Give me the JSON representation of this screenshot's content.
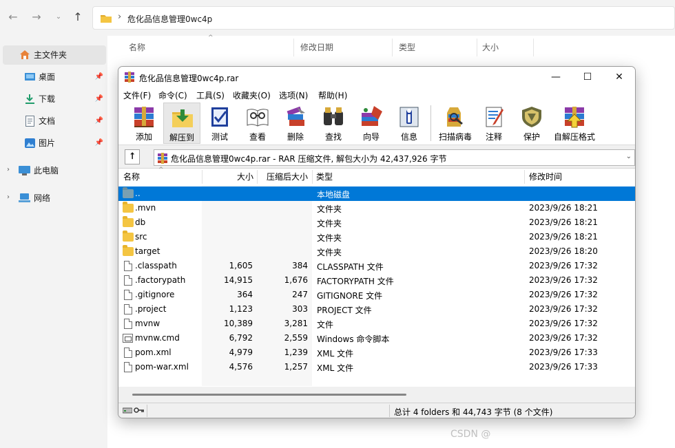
{
  "explorer": {
    "path": "危化品信息管理0wc4p",
    "sidebar": {
      "quick_access": "主文件夹",
      "items": [
        {
          "label": "桌面"
        },
        {
          "label": "下载"
        },
        {
          "label": "文档"
        },
        {
          "label": "图片"
        }
      ],
      "this_pc": "此电脑",
      "network": "网络"
    },
    "columns": [
      "名称",
      "修改日期",
      "类型",
      "大小"
    ]
  },
  "winrar": {
    "title": "危化品信息管理0wc4p.rar",
    "menu": [
      "文件(F)",
      "命令(C)",
      "工具(S)",
      "收藏夹(O)",
      "选项(N)",
      "帮助(H)"
    ],
    "toolbar": [
      {
        "label": "添加",
        "icon": "add-archive-icon"
      },
      {
        "label": "解压到",
        "icon": "extract-to-icon"
      },
      {
        "label": "测试",
        "icon": "test-icon"
      },
      {
        "label": "查看",
        "icon": "view-icon"
      },
      {
        "label": "删除",
        "icon": "delete-icon"
      },
      {
        "label": "查找",
        "icon": "find-icon"
      },
      {
        "label": "向导",
        "icon": "wizard-icon"
      },
      {
        "label": "信息",
        "icon": "info-icon"
      },
      {
        "label": "扫描病毒",
        "icon": "virus-scan-icon"
      },
      {
        "label": "注释",
        "icon": "comment-icon"
      },
      {
        "label": "保护",
        "icon": "protect-icon"
      },
      {
        "label": "自解压格式",
        "icon": "sfx-icon"
      }
    ],
    "path_text": "危化品信息管理0wc4p.rar - RAR 压缩文件, 解包大小为 42,437,926 字节",
    "columns": {
      "name": "名称",
      "size": "大小",
      "packed": "压缩后大小",
      "type": "类型",
      "modified": "修改时间"
    },
    "files": [
      {
        "name": "..",
        "size": "",
        "packed": "",
        "type": "本地磁盘",
        "modified": "",
        "kind": "parent"
      },
      {
        "name": ".mvn",
        "size": "",
        "packed": "",
        "type": "文件夹",
        "modified": "2023/9/26 18:21",
        "kind": "folder"
      },
      {
        "name": "db",
        "size": "",
        "packed": "",
        "type": "文件夹",
        "modified": "2023/9/26 18:21",
        "kind": "folder"
      },
      {
        "name": "src",
        "size": "",
        "packed": "",
        "type": "文件夹",
        "modified": "2023/9/26 18:21",
        "kind": "folder"
      },
      {
        "name": "target",
        "size": "",
        "packed": "",
        "type": "文件夹",
        "modified": "2023/9/26 18:20",
        "kind": "folder"
      },
      {
        "name": ".classpath",
        "size": "1,605",
        "packed": "384",
        "type": "CLASSPATH 文件",
        "modified": "2023/9/26 17:32",
        "kind": "file"
      },
      {
        "name": ".factorypath",
        "size": "14,915",
        "packed": "1,676",
        "type": "FACTORYPATH 文件",
        "modified": "2023/9/26 17:32",
        "kind": "file"
      },
      {
        "name": ".gitignore",
        "size": "364",
        "packed": "247",
        "type": "GITIGNORE 文件",
        "modified": "2023/9/26 17:32",
        "kind": "file"
      },
      {
        "name": ".project",
        "size": "1,123",
        "packed": "303",
        "type": "PROJECT 文件",
        "modified": "2023/9/26 17:32",
        "kind": "file"
      },
      {
        "name": "mvnw",
        "size": "10,389",
        "packed": "3,281",
        "type": "文件",
        "modified": "2023/9/26 17:32",
        "kind": "file"
      },
      {
        "name": "mvnw.cmd",
        "size": "6,792",
        "packed": "2,559",
        "type": "Windows 命令脚本",
        "modified": "2023/9/26 17:32",
        "kind": "cmd"
      },
      {
        "name": "pom.xml",
        "size": "4,979",
        "packed": "1,239",
        "type": "XML 文件",
        "modified": "2023/9/26 17:33",
        "kind": "file"
      },
      {
        "name": "pom-war.xml",
        "size": "4,576",
        "packed": "1,257",
        "type": "XML 文件",
        "modified": "2023/9/26 17:33",
        "kind": "file"
      }
    ],
    "status": "总计 4 folders 和 44,743 字节 (8 个文件)"
  },
  "watermark": "CSDN @",
  "colors": {
    "selection": "#0078d7",
    "folder": "#f4c542"
  }
}
